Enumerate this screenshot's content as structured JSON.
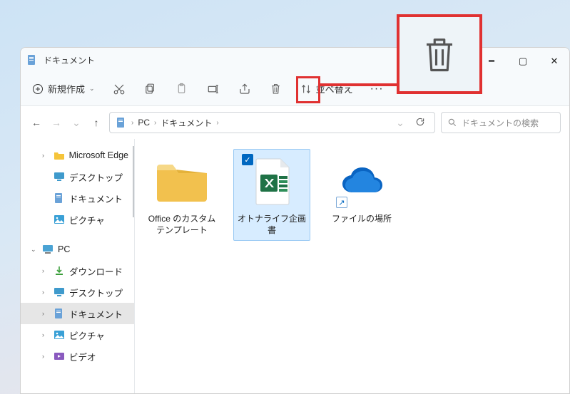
{
  "window": {
    "title": "ドキュメント"
  },
  "toolbar": {
    "new_label": "新規作成",
    "sort_label": "並べ替え"
  },
  "breadcrumb": {
    "root": "PC",
    "folder": "ドキュメント"
  },
  "search": {
    "placeholder": "ドキュメントの検索"
  },
  "sidebar": {
    "quick": [
      {
        "label": "Microsoft Edge",
        "icon": "folder-yellow"
      },
      {
        "label": "デスクトップ",
        "icon": "desktop"
      },
      {
        "label": "ドキュメント",
        "icon": "document"
      },
      {
        "label": "ピクチャ",
        "icon": "pictures"
      }
    ],
    "pc_label": "PC",
    "pc_children": [
      {
        "label": "ダウンロード",
        "icon": "download"
      },
      {
        "label": "デスクトップ",
        "icon": "desktop"
      },
      {
        "label": "ドキュメント",
        "icon": "document",
        "selected": true
      },
      {
        "label": "ピクチャ",
        "icon": "pictures"
      },
      {
        "label": "ビデオ",
        "icon": "video"
      }
    ]
  },
  "files": [
    {
      "label": "Office のカスタム テンプレート",
      "type": "folder"
    },
    {
      "label": "オトナライフ企画書",
      "type": "excel",
      "selected": true
    },
    {
      "label": "ファイルの場所",
      "type": "onedrive",
      "shortcut": true
    }
  ]
}
